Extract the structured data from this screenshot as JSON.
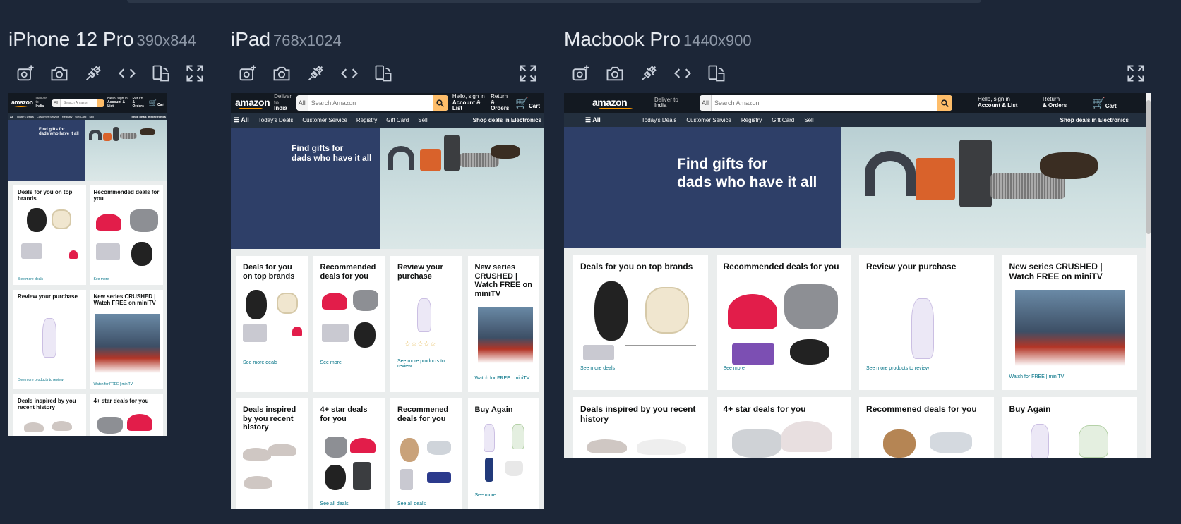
{
  "devices": {
    "iphone": {
      "name": "iPhone 12 Pro",
      "res": "390x844"
    },
    "ipad": {
      "name": "iPad",
      "res": "768x1024"
    },
    "macbook": {
      "name": "Macbook Pro",
      "res": "1440x900"
    }
  },
  "amazon": {
    "logo": "amazon",
    "deliver_to": "Deliver to",
    "location": "India",
    "search_category": "All",
    "search_placeholder": "Search Amazon",
    "hello": "Hello, sign in",
    "account": "Account & List",
    "returns": "Return",
    "orders": "& Orders",
    "cart": "Cart",
    "nav": {
      "all": "All",
      "items": [
        "Today's Deals",
        "Customer Service",
        "Registry",
        "Gift Card",
        "Sell"
      ],
      "right": "Shop deals in Electronics"
    },
    "hero": {
      "line1": "Find gifts for",
      "line2": "dads who have it all"
    },
    "cards": [
      {
        "title": "Deals for you on top brands",
        "link": "See more deals"
      },
      {
        "title": "Recommended deals for you",
        "link": "See more"
      },
      {
        "title": "Review your purchase",
        "link": "See more products to review"
      },
      {
        "title": "New series CRUSHED | Watch FREE on miniTV",
        "link": "Watch for FREE | miniTV"
      },
      {
        "title": "Deals inspired by you recent history",
        "link": "See all deals"
      },
      {
        "title": "4+ star deals for you",
        "link": "See all deals"
      },
      {
        "title": "Recommened deals for you",
        "link": "See all deals"
      },
      {
        "title": "Buy Again",
        "link": "See more"
      }
    ],
    "poster": {
      "title": "CRUSHED",
      "caption": "Watch for FREE | miniTV"
    }
  },
  "icons": [
    "add-photo-icon",
    "camera-icon",
    "plug-icon",
    "code-icon",
    "rotate-icon",
    "fullscreen-icon"
  ]
}
